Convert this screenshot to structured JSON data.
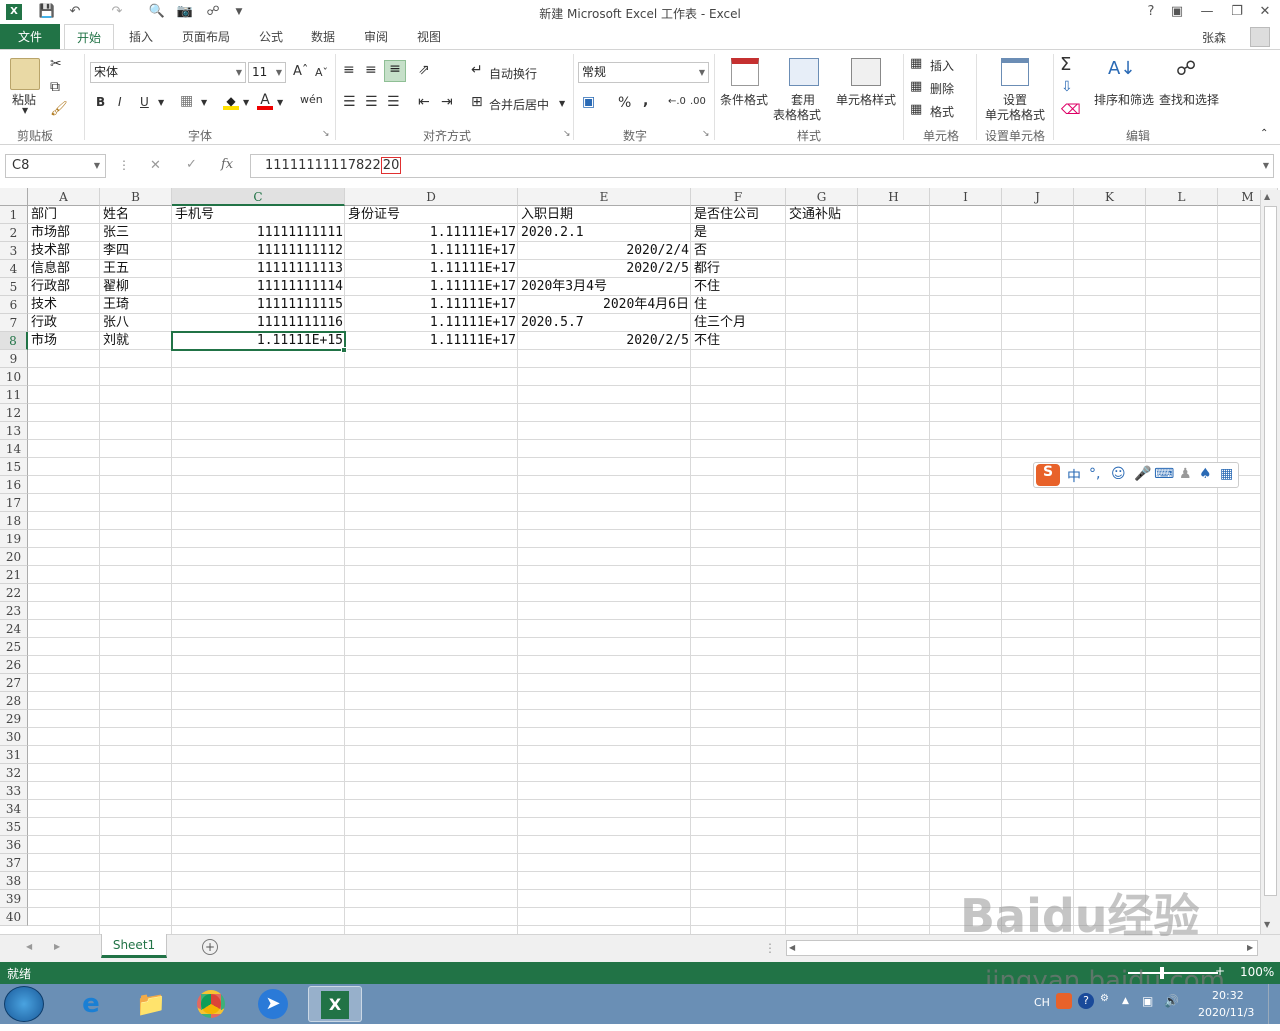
{
  "window": {
    "title": "新建 Microsoft Excel 工作表 - Excel",
    "user": "张森"
  },
  "quick_access": {
    "save_icon": "save-icon",
    "undo_icon": "undo-icon",
    "redo_icon": "redo-icon"
  },
  "tabs": [
    {
      "label": "文件"
    },
    {
      "label": "开始"
    },
    {
      "label": "插入"
    },
    {
      "label": "页面布局"
    },
    {
      "label": "公式"
    },
    {
      "label": "数据"
    },
    {
      "label": "审阅"
    },
    {
      "label": "视图"
    }
  ],
  "ribbon": {
    "clipboard": {
      "paste": "粘贴",
      "group": "剪贴板"
    },
    "font": {
      "name": "宋体",
      "size": "11",
      "bold": "B",
      "italic": "I",
      "underline": "U",
      "group": "字体"
    },
    "align": {
      "wrap": "自动换行",
      "merge": "合并后居中",
      "group": "对齐方式"
    },
    "number": {
      "format": "常规",
      "percent": "%",
      "comma": ",",
      "group": "数字"
    },
    "styles": {
      "cond": "条件格式",
      "table1": "套用",
      "table2": "表格格式",
      "cell": "单元格样式",
      "group": "样式"
    },
    "cells": {
      "insert": "插入",
      "delete": "删除",
      "format": "格式",
      "group": "单元格"
    },
    "setfmt": {
      "l1": "设置",
      "l2": "单元格格式",
      "group": "设置单元格"
    },
    "edit": {
      "sort": "排序和筛选",
      "find": "查找和选择",
      "group": "编辑"
    }
  },
  "formula_bar": {
    "name_box": "C8",
    "fx": "fx",
    "value_main": "11111111117822",
    "value_tail": "20"
  },
  "columns": [
    "A",
    "B",
    "C",
    "D",
    "E",
    "F",
    "G",
    "H",
    "I",
    "J",
    "K",
    "L",
    "M"
  ],
  "rows": [
    "1",
    "2",
    "3",
    "4",
    "5",
    "6",
    "7",
    "8",
    "9",
    "10",
    "11",
    "12",
    "13",
    "14",
    "15",
    "16",
    "17",
    "18",
    "19",
    "20",
    "21",
    "22",
    "23",
    "24",
    "25",
    "26",
    "27",
    "28",
    "29",
    "30",
    "31",
    "32",
    "33",
    "34",
    "35",
    "36",
    "37",
    "38",
    "39",
    "40"
  ],
  "cells": {
    "A1": "部门",
    "B1": "姓名",
    "C1": "手机号",
    "D1": "身份证号",
    "E1": "入职日期",
    "F1": "是否住公司",
    "G1": "交通补贴",
    "A2": "市场部",
    "B2": "张三",
    "C2": "11111111111",
    "D2": "1.11111E+17",
    "E2": "2020.2.1",
    "F2": "是",
    "A3": "技术部",
    "B3": "李四",
    "C3": "11111111112",
    "D3": "1.11111E+17",
    "E3": "2020/2/4",
    "F3": "否",
    "A4": "信息部",
    "B4": "王五",
    "C4": "11111111113",
    "D4": "1.11111E+17",
    "E4": "2020/2/5",
    "F4": "都行",
    "A5": "行政部",
    "B5": "翟柳",
    "C5": "11111111114",
    "D5": "1.11111E+17",
    "E5": "2020年3月4号",
    "F5": "不住",
    "A6": "技术",
    "B6": "王琦",
    "C6": "11111111115",
    "D6": "1.11111E+17",
    "E6": "2020年4月6日",
    "F6": "住",
    "A7": "行政",
    "B7": "张八",
    "C7": "11111111116",
    "D7": "1.11111E+17",
    "E7": "2020.5.7",
    "F7": "住三个月",
    "A8": "市场",
    "B8": "刘就",
    "C8": "1.11111E+15",
    "D8": "1.11111E+17",
    "E8": "2020/2/5",
    "F8": "不住"
  },
  "sheet": {
    "name": "Sheet1"
  },
  "status": {
    "text": "就绪",
    "zoom": "100%"
  },
  "taskbar": {
    "lang": "CH",
    "time": "20:32",
    "date": "2020/11/3"
  },
  "ime": {
    "mode": "中"
  },
  "watermark": {
    "logo": "Baidu经验",
    "url": "jingyan.baidu.com"
  }
}
